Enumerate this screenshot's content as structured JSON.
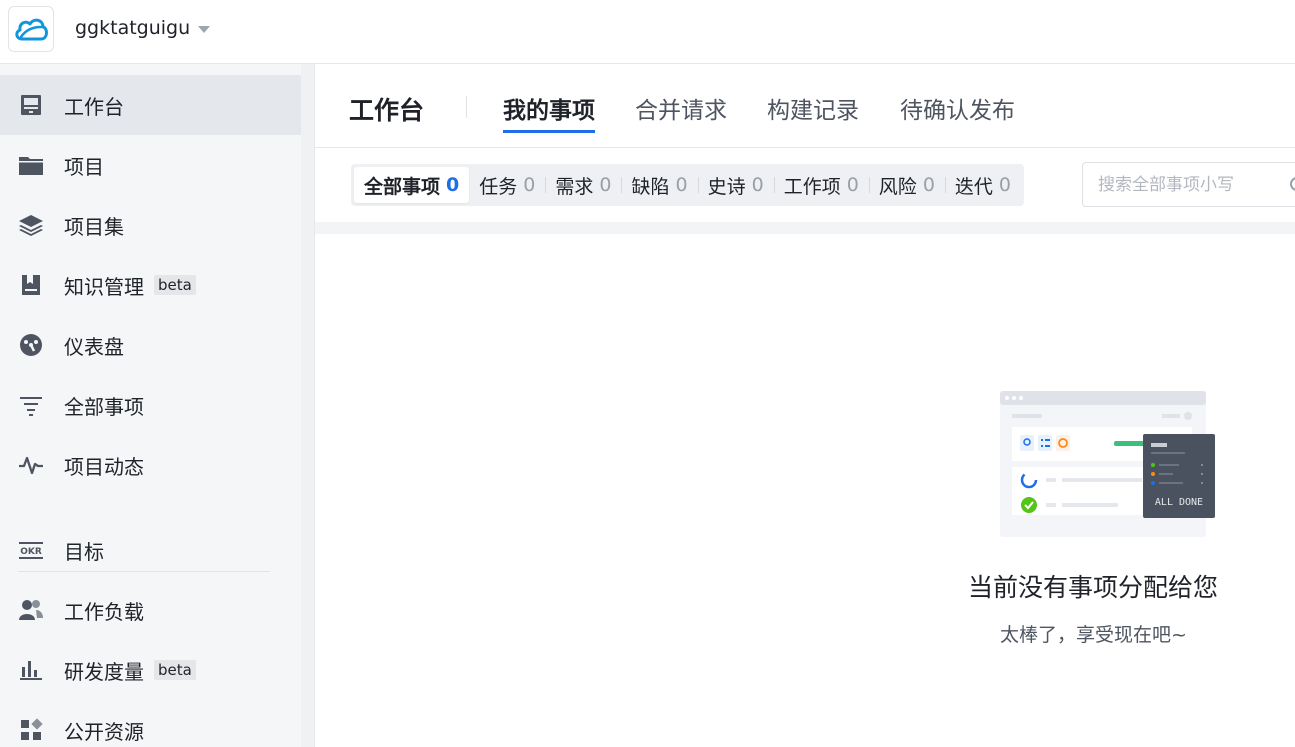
{
  "workspace": {
    "name": "ggktatguigu"
  },
  "sidebar": {
    "items": [
      {
        "label": "工作台",
        "icon": "monitor-icon",
        "active": true,
        "beta": ""
      },
      {
        "label": "项目",
        "icon": "folder-icon",
        "active": false,
        "beta": ""
      },
      {
        "label": "项目集",
        "icon": "layers-icon",
        "active": false,
        "beta": ""
      },
      {
        "label": "知识管理",
        "icon": "book-icon",
        "active": false,
        "beta": "beta"
      },
      {
        "label": "仪表盘",
        "icon": "dashboard-icon",
        "active": false,
        "beta": ""
      },
      {
        "label": "全部事项",
        "icon": "filter-icon",
        "active": false,
        "beta": ""
      },
      {
        "label": "项目动态",
        "icon": "activity-icon",
        "active": false,
        "beta": ""
      },
      {
        "label": "目标",
        "icon": "okr-icon",
        "active": false,
        "beta": ""
      },
      {
        "label": "工作负载",
        "icon": "people-icon",
        "active": false,
        "beta": ""
      },
      {
        "label": "研发度量",
        "icon": "bar-chart-icon",
        "active": false,
        "beta": "beta"
      },
      {
        "label": "公开资源",
        "icon": "grid-icon",
        "active": false,
        "beta": ""
      }
    ]
  },
  "header": {
    "title": "工作台",
    "tabs": [
      {
        "label": "我的事项",
        "active": true
      },
      {
        "label": "合并请求",
        "active": false
      },
      {
        "label": "构建记录",
        "active": false
      },
      {
        "label": "待确认发布",
        "active": false
      }
    ]
  },
  "filters": {
    "segments": [
      {
        "label": "全部事项",
        "count": "0",
        "active": true
      },
      {
        "label": "任务",
        "count": "0",
        "active": false
      },
      {
        "label": "需求",
        "count": "0",
        "active": false
      },
      {
        "label": "缺陷",
        "count": "0",
        "active": false
      },
      {
        "label": "史诗",
        "count": "0",
        "active": false
      },
      {
        "label": "工作项",
        "count": "0",
        "active": false
      },
      {
        "label": "风险",
        "count": "0",
        "active": false
      },
      {
        "label": "迭代",
        "count": "0",
        "active": false
      }
    ],
    "search_placeholder": "搜索全部事项小写"
  },
  "empty_state": {
    "title": "当前没有事项分配给您",
    "subtitle": "太棒了，享受现在吧~",
    "illustration_text": "ALL DONE"
  },
  "colors": {
    "accent": "#1e6ee8",
    "success": "#52c41a",
    "logo": "#1296db"
  }
}
